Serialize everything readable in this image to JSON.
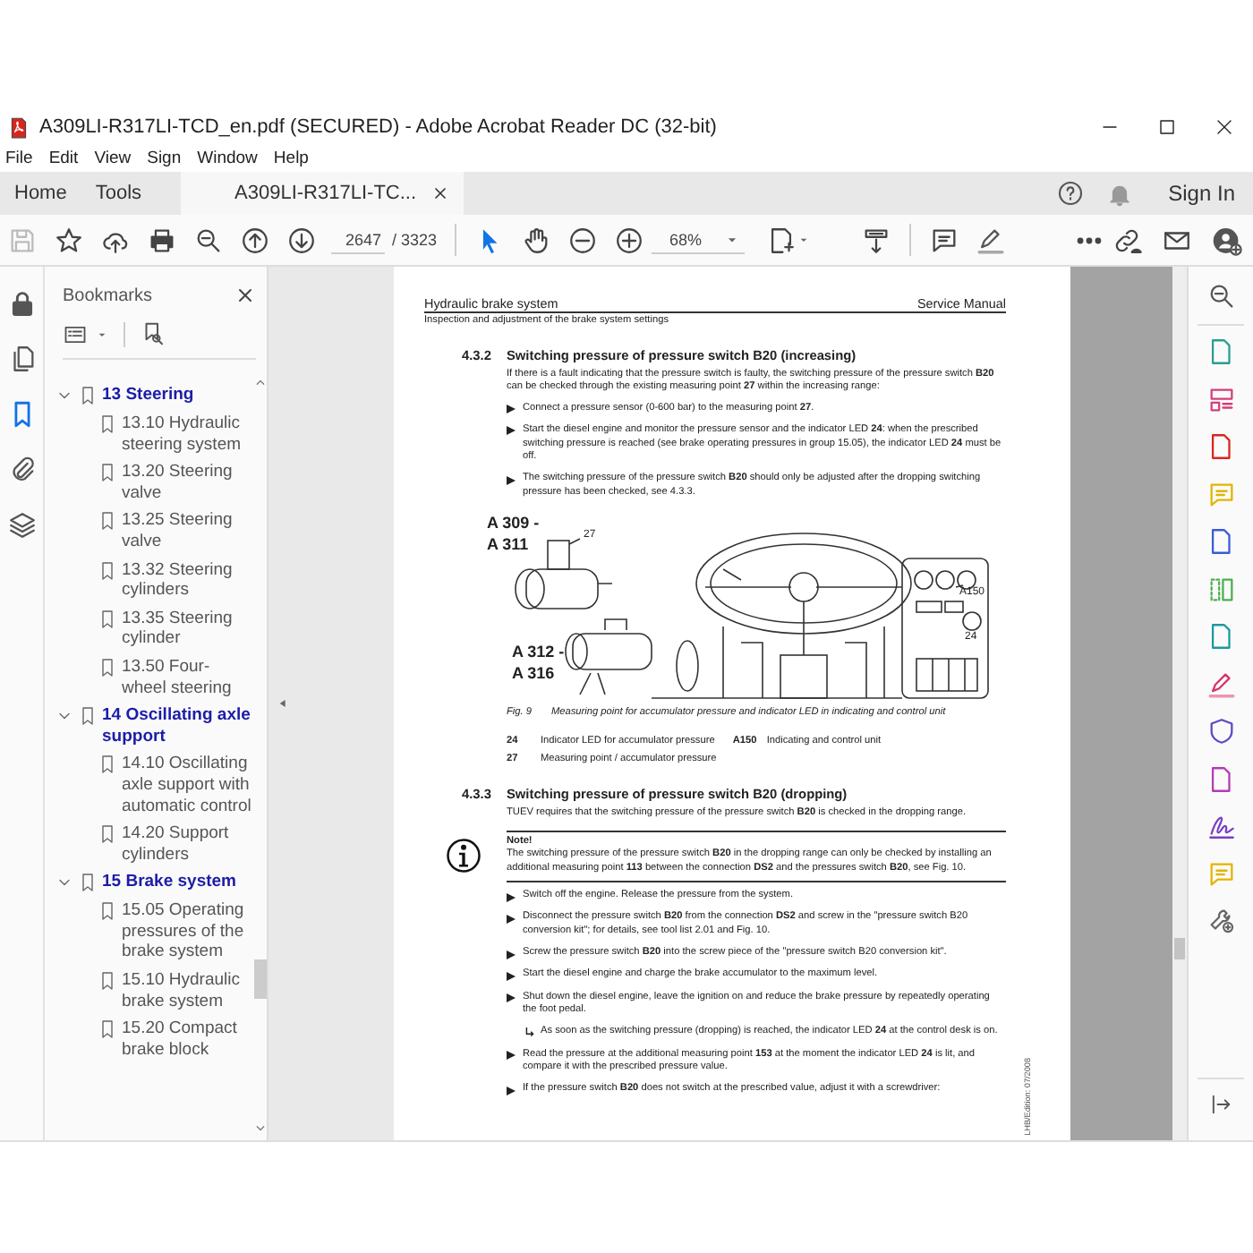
{
  "window": {
    "title": "A309LI-R317LI-TCD_en.pdf (SECURED) - Adobe Acrobat Reader DC (32-bit)",
    "menu": [
      "File",
      "Edit",
      "View",
      "Sign",
      "Window",
      "Help"
    ]
  },
  "tabs": [
    {
      "label": "Home",
      "selected": false
    },
    {
      "label": "Tools",
      "selected": false
    },
    {
      "label": "A309LI-R317LI-TC...",
      "selected": true
    }
  ],
  "account": {
    "sign_in": "Sign In"
  },
  "toolbar": {
    "save_disabled": true,
    "page_number": "2647",
    "page_total": "/ 3323",
    "pointer_tools": [
      {
        "selected": true
      },
      {
        "selected": false
      }
    ],
    "zoom": "68%"
  },
  "nav_rail": [
    {
      "selected": false
    },
    {
      "selected": false
    },
    {
      "selected": true
    },
    {
      "selected": false
    },
    {
      "selected": false
    }
  ],
  "bookmarks": {
    "title": "Bookmarks",
    "items": [
      {
        "label": "13 Steering",
        "expanded": true,
        "children": [
          {
            "label": "13.10 Hydraulic steering system"
          },
          {
            "label": "13.20 Steering valve"
          },
          {
            "label": "13.25 Steering valve"
          },
          {
            "label": "13.32 Steering cylinders"
          },
          {
            "label": "13.35 Steering cylinder"
          },
          {
            "label": "13.50 Four-wheel steering"
          }
        ]
      },
      {
        "label": "14 Oscillating axle support",
        "expanded": true,
        "children": [
          {
            "label": "14.10 Oscillating axle support with automatic control"
          },
          {
            "label": "14.20 Support cylinders"
          }
        ]
      },
      {
        "label": "15 Brake system",
        "expanded": true,
        "children": [
          {
            "label": "15.05 Operating pressures of the brake system"
          },
          {
            "label": "15.10 Hydraulic brake system"
          },
          {
            "label": "15.20 Compact brake block"
          }
        ]
      }
    ]
  },
  "document": {
    "header_left": "Hydraulic brake system",
    "header_right": "Service Manual",
    "subheader": "Inspection and adjustment of the brake system settings",
    "side_text": "LHB/Edition: 07/2008",
    "blocks": [
      {
        "kind": "heading",
        "number": "4.3.2",
        "title": "Switching pressure of pressure switch B20 (increasing)"
      },
      {
        "kind": "para",
        "text": "If there is a fault indicating that the pressure switch is faulty, the switching pressure of the pressure switch **B20** can be checked through the existing measuring point **27** within the increasing range:"
      },
      {
        "kind": "step",
        "text": "Connect a pressure sensor (0-600 bar) to the measuring point **27**."
      },
      {
        "kind": "step",
        "text": "Start the diesel engine and monitor the pressure sensor and the indicator LED **24**: when the prescribed switching pressure is reached (see brake operating pressures in group 15.05), the indicator LED **24** must be off."
      },
      {
        "kind": "step",
        "text": "The switching pressure of the pressure switch **B20** should only be adjusted after the dropping switching pressure has been checked, see 4.3.3."
      },
      {
        "kind": "figure",
        "labels": [
          "A 309 -",
          "A 311",
          "27",
          "A150",
          "24",
          "A 312 -",
          "A 316"
        ]
      },
      {
        "kind": "caption",
        "number": "Fig. 9",
        "text": "Measuring point for accumulator pressure and indicator LED in indicating and control unit"
      },
      {
        "kind": "legend",
        "rows": [
          [
            {
              "key": "24",
              "text": "Indicator LED for accumulator pressure"
            },
            {
              "key": "A150",
              "text": "Indicating and control unit"
            }
          ],
          [
            {
              "key": "27",
              "text": "Measuring point / accumulator pressure"
            }
          ]
        ]
      },
      {
        "kind": "heading",
        "number": "4.3.3",
        "title": "Switching pressure of pressure switch B20 (dropping)"
      },
      {
        "kind": "para",
        "text": "TUEV requires that the switching pressure of the pressure switch **B20** is checked in the dropping range."
      },
      {
        "kind": "note",
        "title": "Note!",
        "text": "The switching pressure of the pressure switch **B20** in the dropping range can only be checked by installing an additional measuring point **113** between the connection **DS2** and the pressures switch **B20**, see Fig. 10."
      },
      {
        "kind": "step",
        "text": "Switch off the engine. Release the pressure from the system."
      },
      {
        "kind": "step",
        "text": "Disconnect the pressure switch **B20** from the connection **DS2** and screw in the \"pressure switch B20 conversion kit\"; for details, see tool list 2.01 and Fig. 10."
      },
      {
        "kind": "step",
        "text": "Screw the pressure switch **B20** into the screw piece of the \"pressure switch B20 conversion kit\"."
      },
      {
        "kind": "step",
        "text": "Start the diesel engine and charge the brake accumulator to the maximum level."
      },
      {
        "kind": "step",
        "text": "Shut down the diesel engine, leave the ignition on and reduce the brake pressure by repeatedly operating the foot pedal."
      },
      {
        "kind": "result",
        "text": "As soon as the switching pressure (dropping) is reached, the indicator LED **24** at the control desk is on."
      },
      {
        "kind": "step",
        "text": "Read the pressure at the additional measuring point **153** at the moment the indicator LED **24** is lit, and compare it with the prescribed pressure value."
      },
      {
        "kind": "step",
        "text": "If the pressure switch **B20** does not switch at the prescribed value, adjust it with a screwdriver:"
      }
    ]
  }
}
